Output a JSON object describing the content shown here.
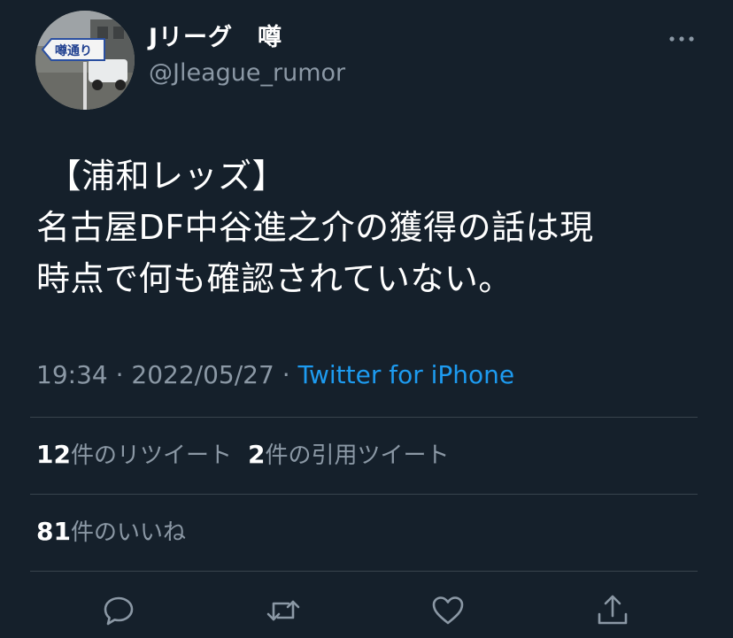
{
  "profile": {
    "display_name": "Jリーグ　噂",
    "handle": "@Jleague_rumor",
    "avatar_sign_text": "噂通り"
  },
  "tweet": {
    "lines": [
      " 【浦和レッズ】",
      "名古屋DF中谷進之介の獲得の話は現",
      "時点で何も確認されていない。"
    ],
    "time": "19:34",
    "date": "2022/05/27",
    "separator": " · ",
    "source": "Twitter for iPhone"
  },
  "stats": {
    "retweets_count": "12",
    "retweets_label": "件のリツイート",
    "quotes_count": "2",
    "quotes_label": "件の引用ツイート",
    "likes_count": "81",
    "likes_label": "件のいいね"
  },
  "actions": {
    "icons": [
      "reply-icon",
      "retweet-icon",
      "like-icon",
      "share-icon"
    ]
  },
  "colors": {
    "background": "#15202b",
    "text_primary": "#ffffff",
    "text_secondary": "#8b98a5",
    "link": "#1d9bf0",
    "divider": "#38444d"
  }
}
